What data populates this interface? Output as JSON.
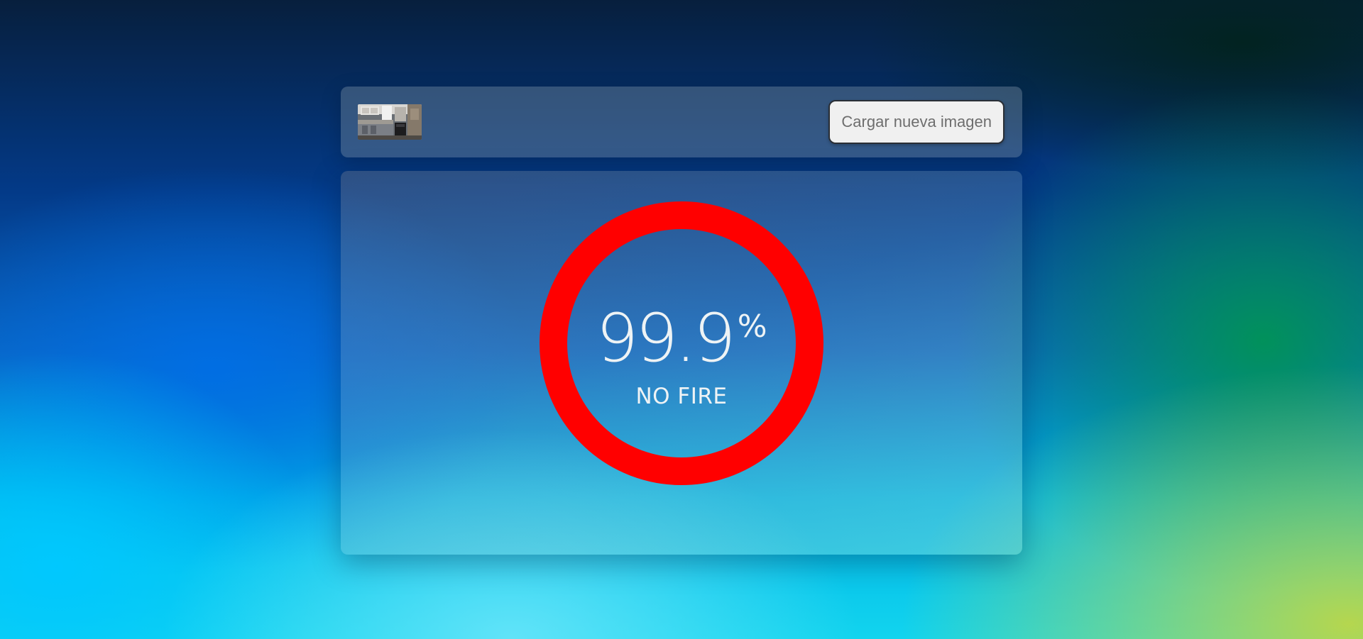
{
  "header": {
    "upload_button_label": "Cargar nueva imagen"
  },
  "result": {
    "value": "99.9",
    "unit": "%",
    "label": "NO FIRE",
    "ring_color": "#ff0000"
  }
}
